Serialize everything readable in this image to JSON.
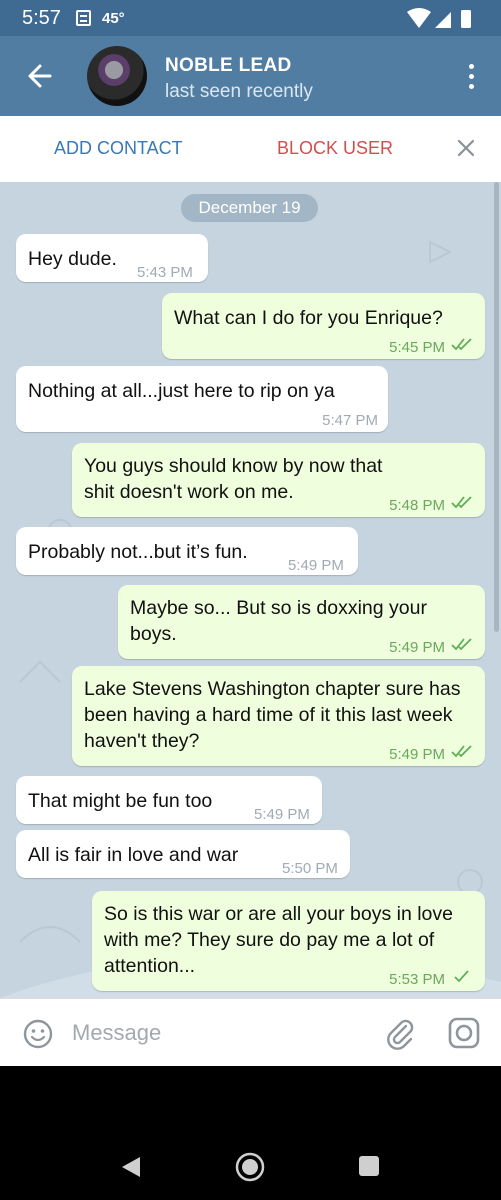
{
  "status_bar": {
    "time": "5:57",
    "temperature": "45°",
    "notification_icon": "notification-doc-icon",
    "right_icons": [
      "wifi-icon",
      "signal-icon",
      "battery-icon"
    ]
  },
  "header": {
    "title": "NOBLE LEAD",
    "status": "last seen recently",
    "color": "#517da2"
  },
  "action_bar": {
    "add_contact": "ADD CONTACT",
    "block_user": "BLOCK USER"
  },
  "chat": {
    "date": "December 19",
    "messages": [
      {
        "direction": "in",
        "text": "Hey dude.",
        "time": "5:43 PM"
      },
      {
        "direction": "out",
        "text": "What can I do for you Enrique?",
        "time": "5:45 PM",
        "status": "read"
      },
      {
        "direction": "in",
        "text": "Nothing at all...just here to rip on ya",
        "time": "5:47 PM"
      },
      {
        "direction": "out",
        "text": "You guys should know by now that shit doesn't work on me.",
        "time": "5:48 PM",
        "status": "read"
      },
      {
        "direction": "in",
        "text": "Probably not...but it’s fun.",
        "time": "5:49 PM"
      },
      {
        "direction": "out",
        "text": "Maybe so... But so is doxxing your boys.",
        "time": "5:49 PM",
        "status": "read"
      },
      {
        "direction": "out",
        "text": "Lake Stevens Washington chapter sure has been having a hard time of it this last week haven't they?",
        "time": "5:49 PM",
        "status": "read"
      },
      {
        "direction": "in",
        "text": "That might be fun too",
        "time": "5:49 PM"
      },
      {
        "direction": "in",
        "text": "All is fair in love and war",
        "time": "5:50 PM"
      },
      {
        "direction": "out",
        "text": "So is this war or are all your boys in love with me? They sure do pay me a lot of attention...",
        "time": "5:53 PM",
        "status": "sent"
      }
    ]
  },
  "input": {
    "placeholder": "Message"
  },
  "nav": {
    "icons": [
      "back-triangle-icon",
      "home-circle-icon",
      "recents-square-icon"
    ]
  }
}
